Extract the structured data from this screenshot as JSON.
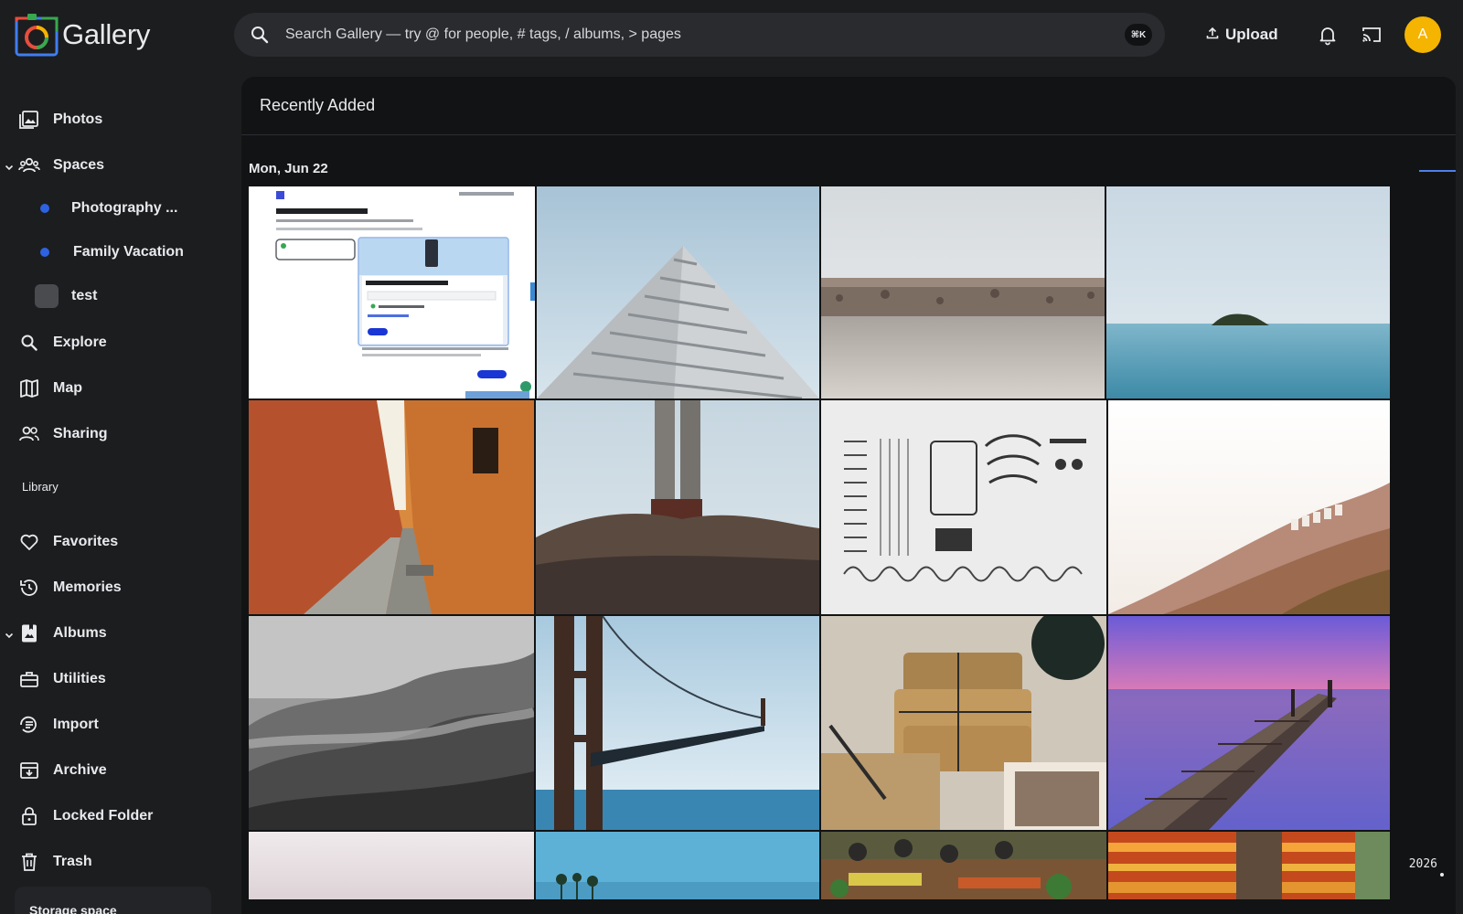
{
  "app": {
    "name": "Gallery"
  },
  "search": {
    "placeholder": "Search Gallery — try @ for people, # tags, / albums, > pages",
    "shortcut": "⌘K"
  },
  "topbar": {
    "upload_label": "Upload",
    "avatar_initial": "A"
  },
  "sidebar": {
    "nav": [
      {
        "label": "Photos",
        "icon": "photos-icon"
      },
      {
        "label": "Spaces",
        "icon": "spaces-icon"
      },
      {
        "label": "Explore",
        "icon": "search-icon"
      },
      {
        "label": "Map",
        "icon": "map-icon"
      },
      {
        "label": "Sharing",
        "icon": "sharing-icon"
      }
    ],
    "spaces": [
      {
        "label": "Photography ..."
      },
      {
        "label": "Family Vacation"
      },
      {
        "label": "test"
      }
    ],
    "library_title": "Library",
    "library": [
      {
        "label": "Favorites",
        "icon": "heart-icon"
      },
      {
        "label": "Memories",
        "icon": "history-icon"
      },
      {
        "label": "Albums",
        "icon": "album-icon"
      },
      {
        "label": "Utilities",
        "icon": "toolbox-icon"
      },
      {
        "label": "Import",
        "icon": "import-icon"
      },
      {
        "label": "Archive",
        "icon": "archive-icon"
      },
      {
        "label": "Locked Folder",
        "icon": "lock-icon"
      },
      {
        "label": "Trash",
        "icon": "trash-icon"
      }
    ],
    "storage_label": "Storage space"
  },
  "main": {
    "title": "Recently Added",
    "date_group": "Mon, Jun 22",
    "timeline_year": "2026",
    "colors": {
      "accent": "#2d63e2",
      "avatar": "#f4b400"
    }
  }
}
